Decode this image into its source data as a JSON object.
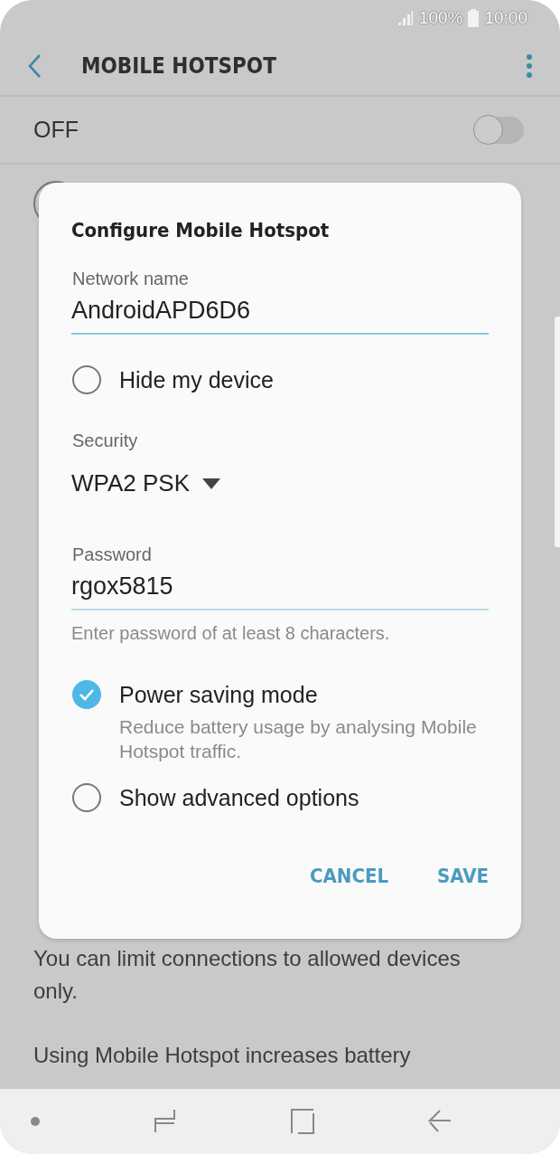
{
  "status_bar": {
    "battery": "100%",
    "time": "10:00"
  },
  "app_bar": {
    "title": "MOBILE HOTSPOT"
  },
  "master_switch": {
    "label": "OFF",
    "on": false
  },
  "background_text": [
    "You can limit connections to allowed devices only.",
    "Using Mobile Hotspot increases battery"
  ],
  "dialog": {
    "title": "Configure Mobile Hotspot",
    "network_name": {
      "label": "Network name",
      "value": "AndroidAPD6D6"
    },
    "hide_device": {
      "label": "Hide my device",
      "checked": false
    },
    "security": {
      "label": "Security",
      "value": "WPA2 PSK"
    },
    "password": {
      "label": "Password",
      "value": "rgox5815",
      "hint": "Enter password of at least 8 characters."
    },
    "power_saving": {
      "label": "Power saving mode",
      "description": "Reduce battery usage by analysing Mobile Hotspot traffic.",
      "checked": true
    },
    "advanced": {
      "label": "Show advanced options",
      "checked": false
    },
    "buttons": [
      "CANCEL",
      "SAVE"
    ]
  }
}
